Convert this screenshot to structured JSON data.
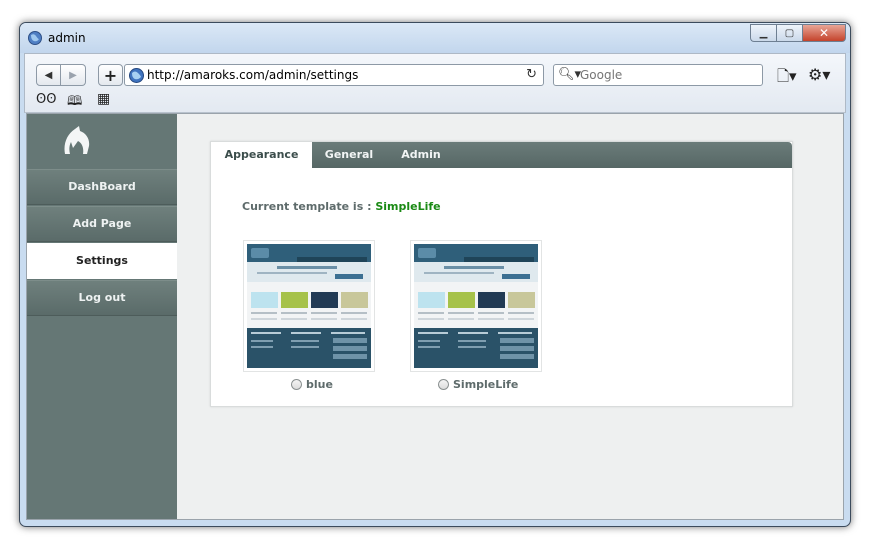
{
  "window": {
    "title": "admin"
  },
  "toolbar": {
    "back_glyph": "◀",
    "forward_glyph": "▶",
    "add_glyph": "+",
    "url": "http://amaroks.com/admin/settings",
    "reload_glyph": "↻",
    "search_placeholder": "Google",
    "search_glyph": "🔍︎▾",
    "page_menu_glyph": "🗋▾",
    "gear_glyph": "⚙▾"
  },
  "window_controls": {
    "minimize": "▁",
    "maximize": "▢",
    "close": "✕"
  },
  "bookmarks": {
    "reader_glyph": "ʘʘ",
    "book_glyph": "🕮",
    "grid_glyph": "▦"
  },
  "sidebar": {
    "items": [
      {
        "label": "DashBoard"
      },
      {
        "label": "Add Page"
      },
      {
        "label": "Settings"
      },
      {
        "label": "Log out"
      }
    ]
  },
  "tabs": [
    {
      "label": "Appearance"
    },
    {
      "label": "General"
    },
    {
      "label": "Admin"
    }
  ],
  "appearance": {
    "current_prefix": "Current template is :",
    "current_name": "SimpleLife",
    "templates": [
      {
        "label": "blue"
      },
      {
        "label": "SimpleLife"
      }
    ]
  },
  "icons": {
    "title": "globe-icon",
    "logo": "wolf-head-logo"
  },
  "colors": {
    "sidebar": "#657775",
    "tabbar": "#607170",
    "current_template": "#1a8a14"
  }
}
